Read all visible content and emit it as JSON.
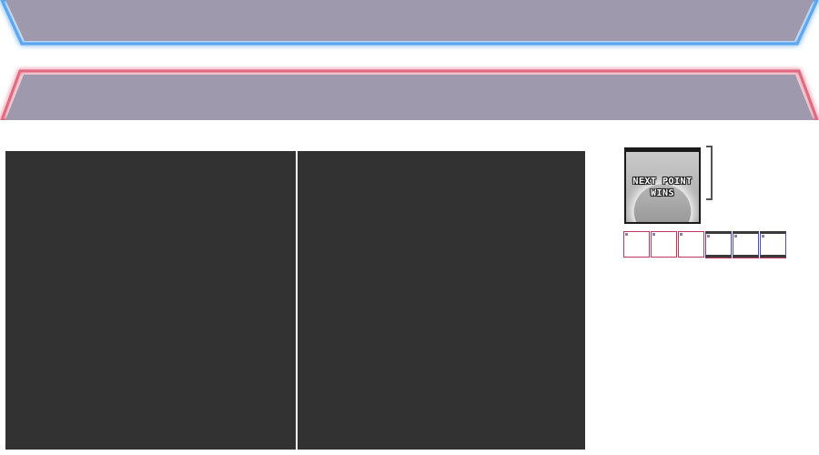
{
  "banners": {
    "top": {
      "color": "#9e99ad",
      "glow": "#5aa6f0",
      "label": ""
    },
    "bottom": {
      "color": "#9e99ad",
      "glow": "#e06a82",
      "label": ""
    }
  },
  "panels": {
    "left": {
      "color": "#323232"
    },
    "right": {
      "color": "#323232"
    }
  },
  "status_card": {
    "line1": "NEXT POINT",
    "line2": "WINS"
  },
  "score_slots": [
    {
      "team": "red",
      "filled": false
    },
    {
      "team": "red",
      "filled": false
    },
    {
      "team": "red",
      "filled": false
    },
    {
      "team": "blue",
      "filled": true
    },
    {
      "team": "blue",
      "filled": true
    },
    {
      "team": "blue",
      "filled": true
    }
  ],
  "colors": {
    "red_team": "#c0395c",
    "blue_team": "#4b4fb8",
    "panel": "#323232"
  }
}
